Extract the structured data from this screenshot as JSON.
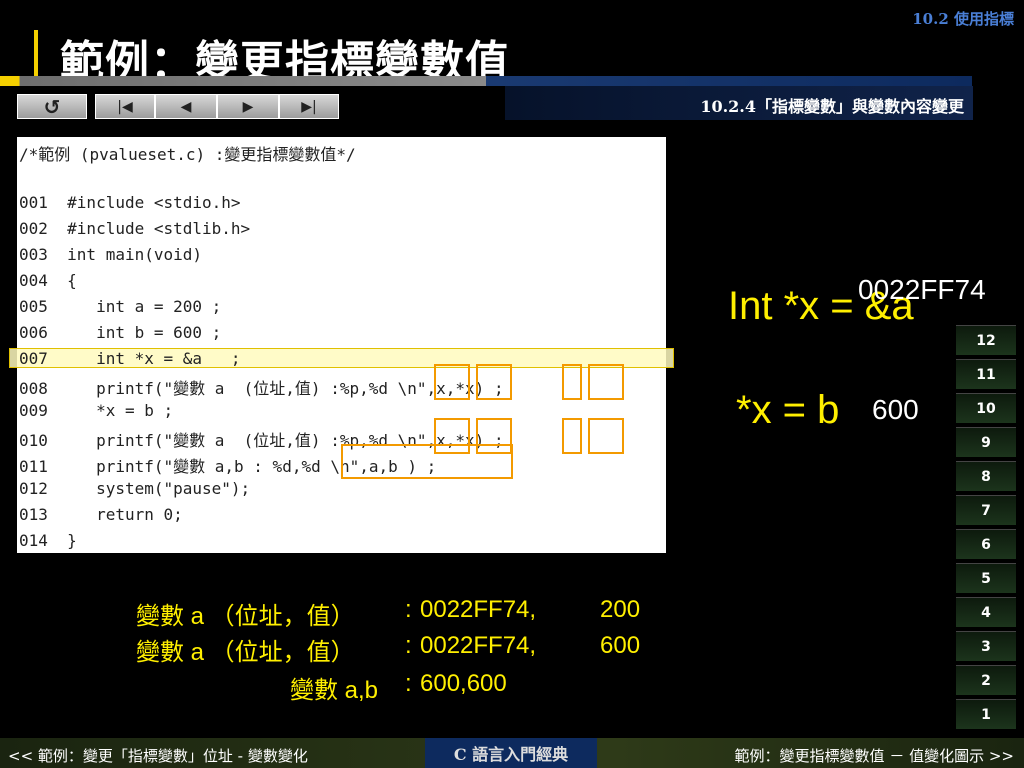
{
  "header": {
    "section_tag": "10.2 使用指標",
    "title": "範例：變更指標變數值",
    "subtitle": "10.2.4「指標變數」與變數內容變更"
  },
  "nav": {
    "return_icon": "return-icon",
    "first_icon": "first-page-icon",
    "prev_icon": "prev-page-icon",
    "next_icon": "next-page-icon",
    "last_icon": "last-page-icon",
    "return_glyph": "↺",
    "first_glyph": "|◀",
    "prev_glyph": "◀",
    "next_glyph": "▶",
    "last_glyph": "▶|"
  },
  "code": {
    "lines": [
      "/*範例 (pvalueset.c) :變更指標變數值*/",
      "",
      "001  #include <stdio.h>",
      "002  #include <stdlib.h>",
      "003  int main(void)",
      "004  {",
      "005     int a = 200 ;",
      "006     int b = 600 ;",
      "007     int *x = &a   ;",
      "008     printf(\"變數 a  (位址,值) :%p,%d \\n\",x,*x) ;",
      "009     *x = b ;",
      "010     printf(\"變數 a  (位址,值) :%p,%d \\n\",x,*x) ;",
      "011     printf(\"變數 a,b : %d,%d \\n\",a,b ) ;",
      "012     system(\"pause\");",
      "013     return 0;",
      "014  }"
    ]
  },
  "annotations": {
    "expr1": "Int *x = &a",
    "addr": "0022FF74",
    "expr2": "*x = b",
    "value": "600"
  },
  "output": {
    "line1_label": "變數 a （位址，值）",
    "line1_sep": ":",
    "line1_addr": "0022FF74,",
    "line1_val": "200",
    "line2_label": "變數 a （位址，值）",
    "line2_sep": ":",
    "line2_addr": "0022FF74,",
    "line2_val": "600",
    "line3_label": "變數 a,b",
    "line3_sep": ":",
    "line3_val": "600,600"
  },
  "stack": {
    "cells": [
      "12",
      "11",
      "10",
      "9",
      "8",
      "7",
      "6",
      "5",
      "4",
      "3",
      "2",
      "1"
    ]
  },
  "footer": {
    "prev_link": "<< 範例：變更「指標變數」位址 -  變數變化",
    "center": "C 語言入門經典",
    "next_link": "範例：變更指標變數值 － 值變化圖示 >>"
  },
  "colors": {
    "accent_yellow": "#ffef00",
    "box_orange": "#f39a00",
    "title_bar_yellow": "#f5d000",
    "sub_bar_blue": "#10234a"
  }
}
